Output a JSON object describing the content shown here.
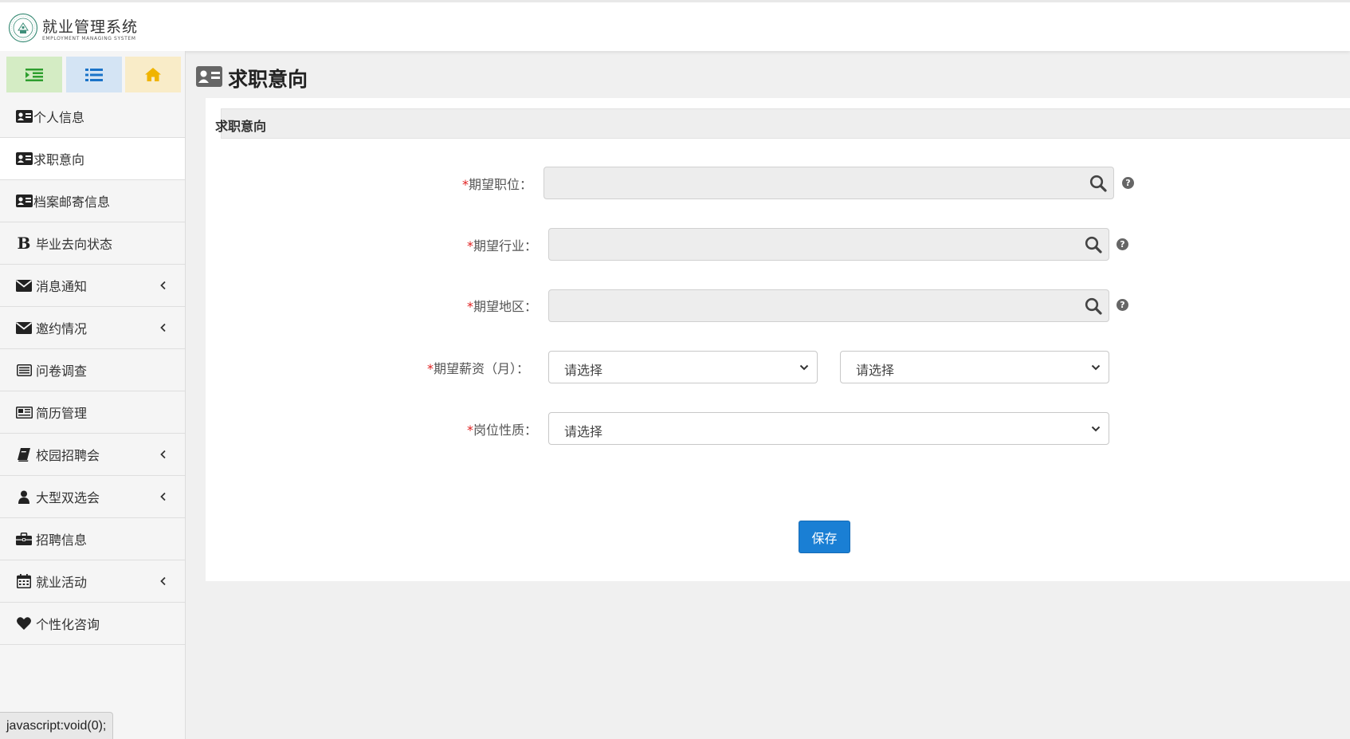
{
  "header": {
    "title": "就业管理系统",
    "subtitle": "EMPLOYMENT MANAGING SYSTEM",
    "logo_icon": "university-seal-icon"
  },
  "sidebar": {
    "quick_buttons": [
      {
        "icon": "indent-icon",
        "color": "#2e9e2e"
      },
      {
        "icon": "list-icon",
        "color": "#1a73c8"
      },
      {
        "icon": "home-icon",
        "color": "#f0b400"
      }
    ],
    "items": [
      {
        "label": "个人信息",
        "icon": "id-card-icon",
        "expandable": false,
        "active": false
      },
      {
        "label": "求职意向",
        "icon": "id-card-icon",
        "expandable": false,
        "active": true
      },
      {
        "label": "档案邮寄信息",
        "icon": "id-card-icon",
        "expandable": false,
        "active": false
      },
      {
        "label": "毕业去向状态",
        "icon": "bold-b-icon",
        "expandable": false,
        "active": false
      },
      {
        "label": "消息通知",
        "icon": "envelope-icon",
        "expandable": true,
        "active": false
      },
      {
        "label": "邀约情况",
        "icon": "envelope-icon",
        "expandable": true,
        "active": false
      },
      {
        "label": "问卷调查",
        "icon": "list-alt-icon",
        "expandable": false,
        "active": false
      },
      {
        "label": "简历管理",
        "icon": "newspaper-icon",
        "expandable": false,
        "active": false
      },
      {
        "label": "校园招聘会",
        "icon": "book-icon",
        "expandable": true,
        "active": false
      },
      {
        "label": "大型双选会",
        "icon": "user-icon",
        "expandable": true,
        "active": false
      },
      {
        "label": "招聘信息",
        "icon": "briefcase-icon",
        "expandable": false,
        "active": false
      },
      {
        "label": "就业活动",
        "icon": "calendar-icon",
        "expandable": true,
        "active": false
      },
      {
        "label": "个性化咨询",
        "icon": "heart-icon",
        "expandable": false,
        "active": false
      }
    ]
  },
  "page": {
    "title": "求职意向",
    "title_icon": "id-card-icon",
    "panel_title": "求职意向"
  },
  "form": {
    "required_mark": "*",
    "position": {
      "label": "期望职位：",
      "value": ""
    },
    "industry": {
      "label": "期望行业：",
      "value": ""
    },
    "region": {
      "label": "期望地区：",
      "value": ""
    },
    "salary": {
      "label": "期望薪资（月）：",
      "min_selected": "请选择",
      "max_selected": "请选择"
    },
    "job_nature": {
      "label": "岗位性质：",
      "selected": "请选择"
    },
    "help_glyph": "?",
    "save_label": "保存"
  },
  "statusbar": {
    "link_preview": "javascript:void(0);"
  },
  "colors": {
    "accent": "#1a7fd4",
    "required": "#e02020"
  }
}
